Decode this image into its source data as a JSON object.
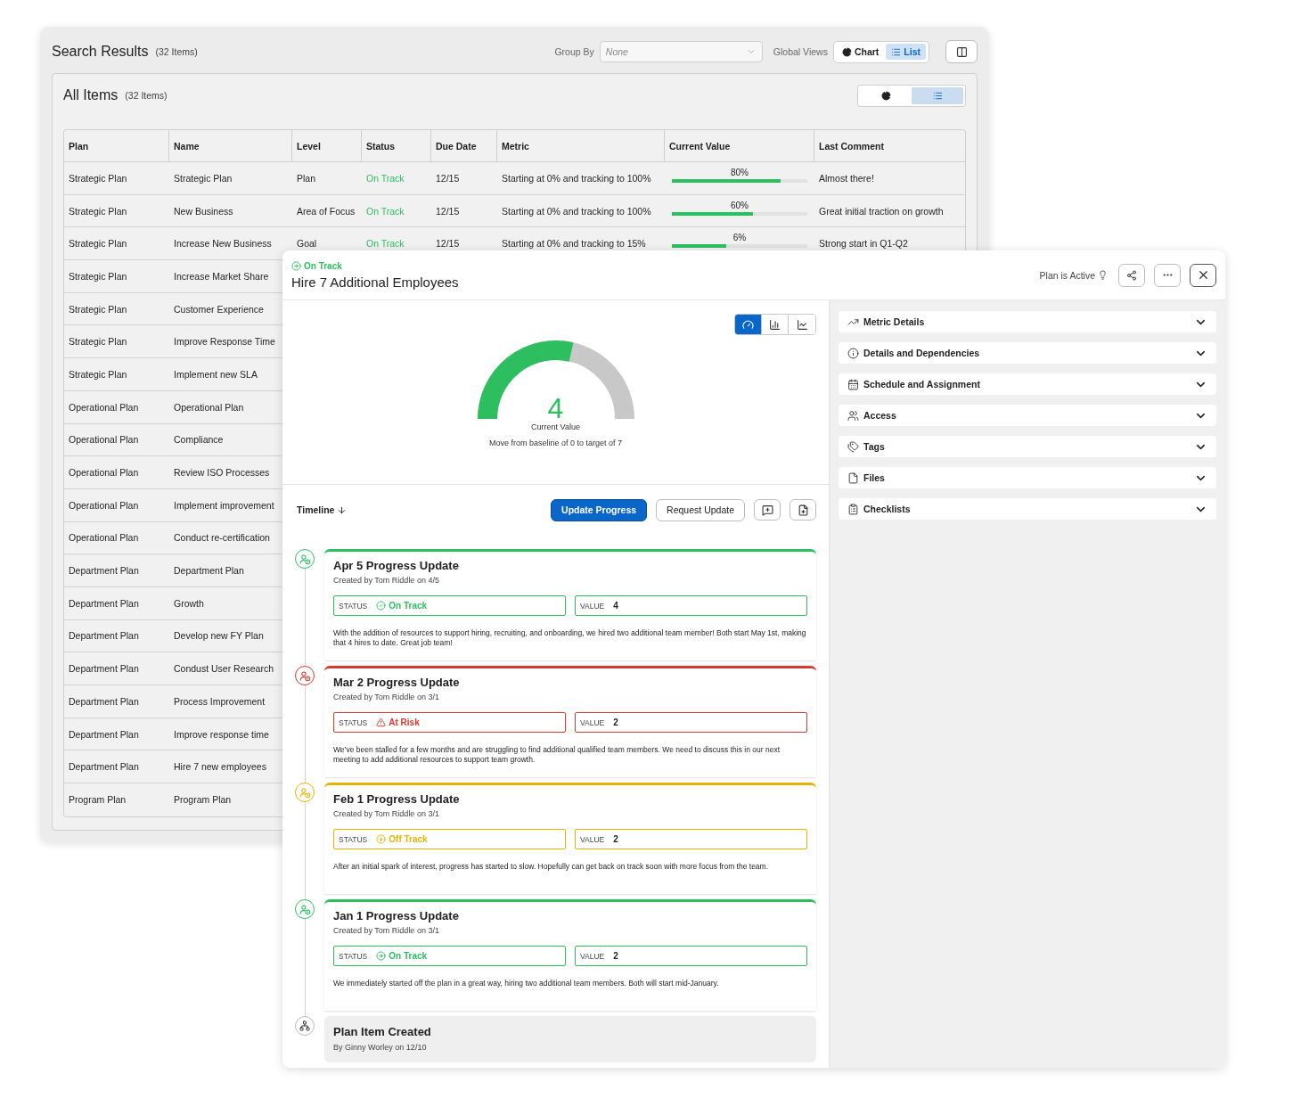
{
  "search_results": {
    "title": "Search Results",
    "count": "(32 Items)",
    "group_by": {
      "label": "Group By",
      "placeholder": "None"
    },
    "global_views": {
      "label": "Global Views",
      "options": [
        {
          "kind": "chart",
          "label": "Chart",
          "selected": false
        },
        {
          "kind": "list",
          "label": "List",
          "selected": true
        }
      ]
    }
  },
  "all_items": {
    "title": "All Items",
    "count": "(32 Items)",
    "view_toggle": [
      {
        "kind": "chart",
        "selected": false
      },
      {
        "kind": "list",
        "selected": true
      }
    ],
    "table": {
      "columns": [
        "Plan",
        "Name",
        "Level",
        "Status",
        "Due Date",
        "Metric",
        "Current Value",
        "Last Comment"
      ],
      "rows": [
        {
          "plan": "Strategic Plan",
          "name": "Strategic Plan",
          "level": "Plan",
          "status": "On Track",
          "color": "#2dbe60",
          "due_date": "12/15",
          "metric": "Starting at 0% and tracking to 100%",
          "current_value": {
            "reading": "80%",
            "level": 0.8
          },
          "last_comment": "Almost there!"
        },
        {
          "plan": "Strategic Plan",
          "name": "New Business",
          "level": "Area of Focus",
          "status": "On Track",
          "color": "#2dbe60",
          "due_date": "12/15",
          "metric": "Starting at 0% and tracking to 100%",
          "current_value": {
            "reading": "60%",
            "level": 0.6
          },
          "last_comment": "Great initial traction on growth"
        },
        {
          "plan": "Strategic Plan",
          "name": "Increase New Business",
          "level": "Goal",
          "status": "On Track",
          "color": "#2dbe60",
          "due_date": "12/15",
          "metric": "Starting at 0% and tracking to 15%",
          "current_value": {
            "reading": "6%",
            "level": 0.4
          },
          "last_comment": "Strong start in Q1-Q2"
        },
        {
          "plan": "Strategic Plan",
          "name": "Increase Market Share"
        },
        {
          "plan": "Strategic Plan",
          "name": "Customer Experience"
        },
        {
          "plan": "Strategic Plan",
          "name": "Improve Response Time"
        },
        {
          "plan": "Strategic Plan",
          "name": "Implement new SLA"
        },
        {
          "plan": "Operational Plan",
          "name": "Operational Plan"
        },
        {
          "plan": "Operational Plan",
          "name": "Compliance"
        },
        {
          "plan": "Operational Plan",
          "name": "Review ISO Processes"
        },
        {
          "plan": "Operational Plan",
          "name": "Implement improvement"
        },
        {
          "plan": "Operational Plan",
          "name": "Conduct re-certification"
        },
        {
          "plan": "Department Plan",
          "name": "Department Plan"
        },
        {
          "plan": "Department Plan",
          "name": "Growth"
        },
        {
          "plan": "Department Plan",
          "name": "Develop new FY Plan"
        },
        {
          "plan": "Department Plan",
          "name": "Condust User Research"
        },
        {
          "plan": "Department Plan",
          "name": "Process Improvement"
        },
        {
          "plan": "Department Plan",
          "name": "Improve response time"
        },
        {
          "plan": "Department Plan",
          "name": "Hire 7 new employees"
        },
        {
          "plan": "Program Plan",
          "name": "Program Plan"
        }
      ]
    }
  },
  "detail": {
    "status": {
      "label": "On Track",
      "color": "#2dbe60"
    },
    "title": "Hire 7 Additional Employees",
    "plan_state": "Plan is Active",
    "metric_views": [
      {
        "kind": "gauge",
        "selected": true
      },
      {
        "kind": "bar",
        "selected": false
      },
      {
        "kind": "line",
        "selected": false
      }
    ],
    "gauge": {
      "value": "4",
      "label": "Current Value",
      "caption": "Move from baseline of 0 to target of 7",
      "level": 0.571
    },
    "timeline": {
      "label": "Timeline",
      "buttons": [
        {
          "kind": "primary",
          "label": "Update Progress"
        },
        {
          "kind": "secondary",
          "label": "Request Update"
        }
      ]
    },
    "updates": [
      {
        "title": "Apr 5 Progress Update",
        "byline": "Created by Tom Riddle on 4/5",
        "status_label": "STATUS",
        "status": "On Track",
        "kind": "done",
        "color": "#2dbe60",
        "value_label": "VALUE",
        "value": "4",
        "note": "With the addition of resources to support hiring, recruiting, and onboarding, we hired two additional team member! Both start May 1st, making that 4 hires to date. Great job team!"
      },
      {
        "title": "Mar 2 Progress Update",
        "byline": "Created by Tom Riddle on 3/1",
        "status_label": "STATUS",
        "status": "At Risk",
        "kind": "risk",
        "color": "#d93a2e",
        "value_label": "VALUE",
        "value": "2",
        "note": "We’ve been stalled for a few months and are struggling to find additional qualified team members. We need to discuss this in our next meeting to add additional resources to support team growth."
      },
      {
        "title": "Feb 1 Progress Update",
        "byline": "Created by Tom Riddle on 3/1",
        "status_label": "STATUS",
        "status": "Off Track",
        "kind": "behind",
        "color": "#e6b400",
        "value_label": "VALUE",
        "value": "2",
        "note": "After an initial spark of interest, progress has started to slow. Hopefully can get back on track soon with more focus from the team."
      },
      {
        "title": "Jan 1 Progress Update",
        "byline": "Created by Tom Riddle on 3/1",
        "status_label": "STATUS",
        "status": "On Track",
        "kind": "ahead",
        "color": "#2dbe60",
        "value_label": "VALUE",
        "value": "2",
        "note": "We immediately started off the plan in a great way, hiring two additional team members. Both will start mid-January."
      }
    ],
    "created": {
      "title": "Plan Item Created",
      "byline": "By Ginny Worley on 12/10"
    },
    "sections": [
      {
        "kind": "metric",
        "label": "Metric Details"
      },
      {
        "kind": "details",
        "label": "Details and Dependencies"
      },
      {
        "kind": "schedule",
        "label": "Schedule and Assignment"
      },
      {
        "kind": "access",
        "label": "Access"
      },
      {
        "kind": "tags",
        "label": "Tags"
      },
      {
        "kind": "files",
        "label": "Files"
      },
      {
        "kind": "checklists",
        "label": "Checklists"
      }
    ]
  }
}
